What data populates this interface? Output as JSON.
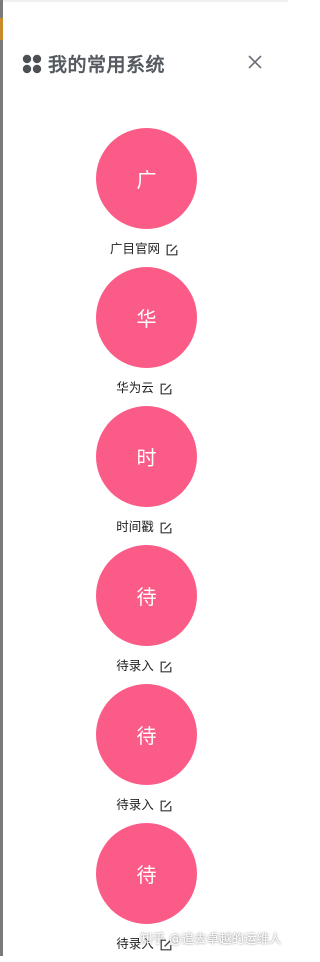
{
  "header": {
    "title": "我的常用系统",
    "icon": "apps-icon",
    "close_icon": "close-icon"
  },
  "apps": [
    {
      "initial": "广",
      "label": "广目官网"
    },
    {
      "initial": "华",
      "label": "华为云"
    },
    {
      "initial": "时",
      "label": "时间戳"
    },
    {
      "initial": "待",
      "label": "待录入"
    },
    {
      "initial": "待",
      "label": "待录入"
    },
    {
      "initial": "待",
      "label": "待录入"
    }
  ],
  "watermark": "知乎 @追去卓越的运维人",
  "colors": {
    "circle": "#fb5c87",
    "title": "#555a60"
  }
}
